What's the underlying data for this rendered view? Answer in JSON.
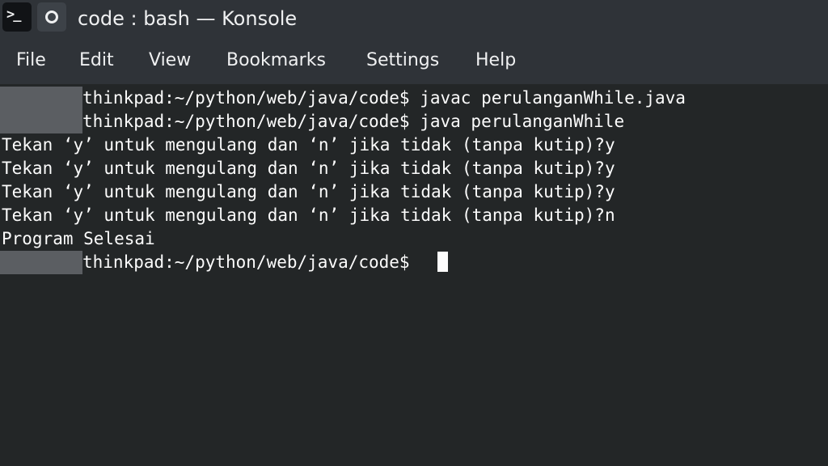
{
  "window": {
    "title": "code : bash — Konsole",
    "app_icon": "terminal-icon",
    "pin_icon": "pin-icon"
  },
  "menu": {
    "file": "File",
    "edit": "Edit",
    "view": "View",
    "bookmarks": "Bookmarks",
    "settings": "Settings",
    "help": "Help"
  },
  "terminal": {
    "lines": [
      "thinkpad:~/python/web/java/code$ javac perulanganWhile.java",
      "thinkpad:~/python/web/java/code$ java perulanganWhile",
      "Tekan ‘y’ untuk mengulang dan ‘n’ jika tidak (tanpa kutip)?y",
      "Tekan ‘y’ untuk mengulang dan ‘n’ jika tidak (tanpa kutip)?y",
      "Tekan ‘y’ untuk mengulang dan ‘n’ jika tidak (tanpa kutip)?y",
      "Tekan ‘y’ untuk mengulang dan ‘n’ jika tidak (tanpa kutip)?n",
      "Program Selesai",
      "thinkpad:~/python/web/java/code$ "
    ]
  },
  "colors": {
    "titlebar_bg": "#2f3338",
    "terminal_bg": "#232627",
    "terminal_fg": "#fcfcfc",
    "redaction_mask": "#5b5e62"
  }
}
